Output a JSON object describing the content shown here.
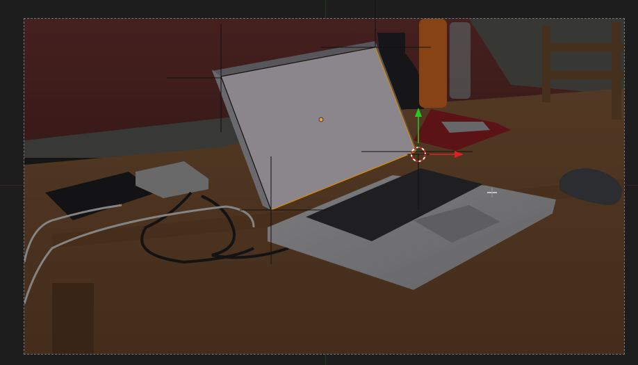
{
  "viewport": {
    "background_color": "#1d1d1d",
    "frame_border_color": "#7a7a7a"
  },
  "scene": {
    "wall_color": "#5a2a28",
    "table_color": "#6b4a2e",
    "screen_plane_color": "#8a868c",
    "laptop_body_color": "#9a9a9e",
    "keyboard_color": "#2a2a2c",
    "mouse_color": "#3a3c40",
    "chair_color": "#5d4028",
    "cable_color": "#9a9a9a"
  },
  "gizmo": {
    "x_axis_color": "#e02020",
    "y_axis_color": "#22cc22",
    "selection_outline_color": "#e08a00",
    "origin_color": "#f0a040",
    "icons": [
      "3d-cursor-icon",
      "transform-gizmo-icon",
      "mouse-cursor-crosshair-icon"
    ]
  }
}
